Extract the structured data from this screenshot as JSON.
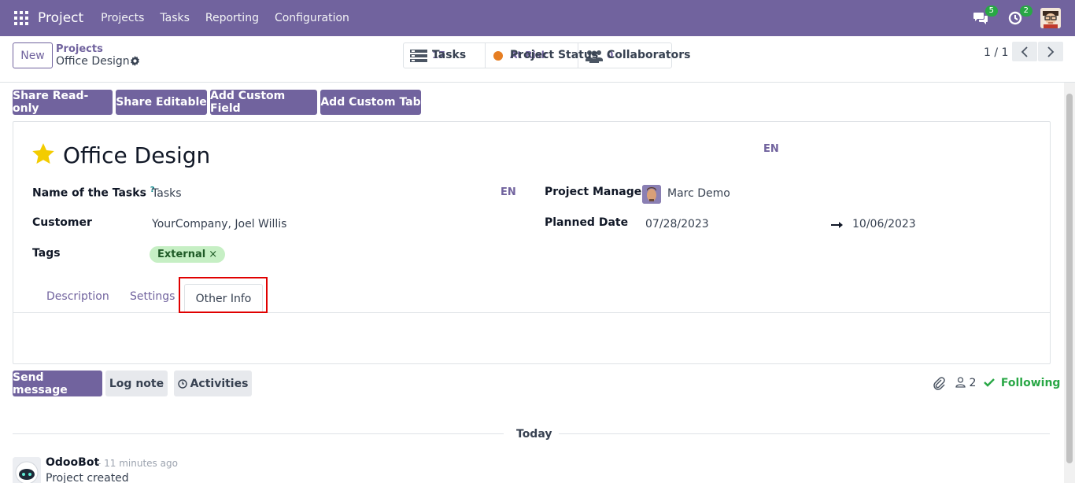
{
  "navbar": {
    "app_name": "Project",
    "menu": [
      "Projects",
      "Tasks",
      "Reporting",
      "Configuration"
    ],
    "messages_count": "5",
    "activities_count": "2",
    "accent_color": "#71639e"
  },
  "control": {
    "new_label": "New",
    "breadcrumb_parent": "Projects",
    "breadcrumb_current": "Office Design",
    "stats": {
      "tasks_label": "Tasks",
      "tasks_value": "17",
      "status_label": "Project Status",
      "status_value": "At Risk",
      "collab_label": "Collaborators",
      "collab_value": "0"
    },
    "pager": "1 / 1"
  },
  "actions": {
    "share_readonly": "Share Read-only",
    "share_editable": "Share Editable",
    "add_field": "Add Custom Field",
    "add_tab": "Add Custom Tab"
  },
  "form": {
    "title": "Office Design",
    "lang": "EN",
    "tasks_name_label": "Name of the Tasks",
    "help_mark": "?",
    "tasks_name_value": "Tasks",
    "customer_label": "Customer",
    "customer_value": "YourCompany, Joel Willis",
    "tags_label": "Tags",
    "tag_value": "External",
    "tag_remove": "×",
    "manager_label": "Project Manager",
    "manager_value": "Marc Demo",
    "planned_label": "Planned Date",
    "date_start": "07/28/2023",
    "date_end": "10/06/2023",
    "tabs": [
      "Description",
      "Settings",
      "Other Info"
    ]
  },
  "chatter": {
    "send_message": "Send message",
    "log_note": "Log note",
    "activities": "Activities",
    "followers_count": "2",
    "following_label": "Following",
    "today_label": "Today",
    "author": "OdooBot",
    "time": "- 11 minutes ago",
    "message": "Project created"
  }
}
